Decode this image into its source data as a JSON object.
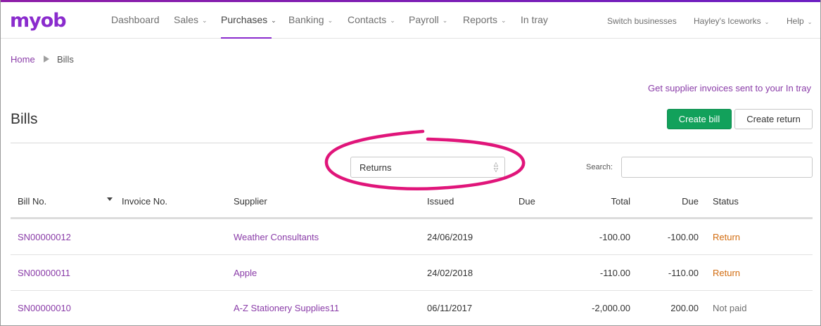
{
  "app": {
    "logo": "myob"
  },
  "nav": {
    "items": [
      {
        "label": "Dashboard",
        "has_menu": false
      },
      {
        "label": "Sales",
        "has_menu": true
      },
      {
        "label": "Purchases",
        "has_menu": true,
        "active": true
      },
      {
        "label": "Banking",
        "has_menu": true
      },
      {
        "label": "Contacts",
        "has_menu": true
      },
      {
        "label": "Payroll",
        "has_menu": true
      },
      {
        "label": "Reports",
        "has_menu": true
      },
      {
        "label": "In tray",
        "has_menu": false
      }
    ],
    "right": {
      "switch": "Switch businesses",
      "business": "Hayley's Iceworks",
      "help": "Help"
    }
  },
  "breadcrumb": {
    "home": "Home",
    "current": "Bills"
  },
  "promo_link": "Get supplier invoices sent to your In tray",
  "page": {
    "title": "Bills"
  },
  "actions": {
    "create_bill": "Create bill",
    "create_return": "Create return"
  },
  "filter": {
    "selected": "Returns"
  },
  "search": {
    "label": "Search:",
    "value": ""
  },
  "table": {
    "headers": {
      "bill_no": "Bill No.",
      "invoice_no": "Invoice No.",
      "supplier": "Supplier",
      "issued": "Issued",
      "due_date": "Due",
      "total": "Total",
      "due_amount": "Due",
      "status": "Status"
    },
    "rows": [
      {
        "bill_no": "SN00000012",
        "invoice_no": "",
        "supplier": "Weather Consultants",
        "issued": "24/06/2019",
        "due_date": "",
        "total": "-100.00",
        "due_amount": "-100.00",
        "status": "Return"
      },
      {
        "bill_no": "SN00000011",
        "invoice_no": "",
        "supplier": "Apple",
        "issued": "24/02/2018",
        "due_date": "",
        "total": "-110.00",
        "due_amount": "-110.00",
        "status": "Return"
      },
      {
        "bill_no": "SN00000010",
        "invoice_no": "",
        "supplier": "A-Z Stationery Supplies11",
        "issued": "06/11/2017",
        "due_date": "",
        "total": "-2,000.00",
        "due_amount": "200.00",
        "status": "Not paid"
      }
    ]
  },
  "colors": {
    "brand": "#8a2bcd",
    "link": "#8a3ca8",
    "primary_button": "#12a15b",
    "status_return": "#d26c10",
    "annotation": "#e0157a"
  }
}
